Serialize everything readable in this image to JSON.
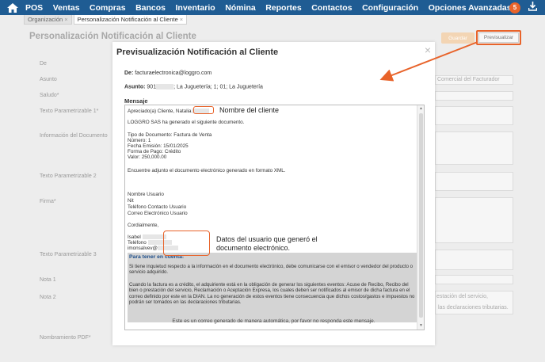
{
  "nav": {
    "items": [
      "POS",
      "Ventas",
      "Compras",
      "Bancos",
      "Inventario",
      "Nómina",
      "Reportes",
      "Contactos",
      "Configuración",
      "Opciones Avanzadas"
    ],
    "notification_count": "5"
  },
  "tabs": [
    {
      "label": "Organización",
      "close": "×"
    },
    {
      "label": "Personalización Notificación al Cliente",
      "close": "×"
    }
  ],
  "page": {
    "title": "Personalización Notificación al Cliente",
    "save_label": "Guardar",
    "preview_label": "Previsualizar",
    "labels": [
      "De",
      "Asunto",
      "Saludo*",
      "Texto Parametrizable 1*",
      "Información del Documento",
      "Texto Parametrizable 2",
      "Firma*",
      "Texto Parametrizable 3",
      "Nota 1",
      "Nota 2",
      "Nombramiento PDF*"
    ],
    "asunto_fragment": "Comercial del Facturador",
    "nota2_line1": "estación del servicio,",
    "nota2_line2": "las declaraciones tributarias."
  },
  "modal": {
    "title": "Previsualización Notificación al Cliente",
    "close": "×",
    "de_label": "De:",
    "de_value": "facturaelectronica@loggro.com",
    "asunto_label": "Asunto:",
    "asunto_prefix": "901",
    "asunto_rest": "; La Juguetería; 1; 01; La Juguetería",
    "mensaje_label": "Mensaje",
    "msg": {
      "greeting": "Apreciado(a) Cliente,",
      "greeting_name": "Natalia",
      "intro": "LOGGRO SAS ha generado el siguiente documento.",
      "doc_type_label": "Tipo de Documento:",
      "doc_type_value": "Factura de Venta",
      "number_label": "Número:",
      "number_value": "1",
      "date_label": "Fecha Emisión:",
      "date_value": "15/01/2025",
      "payment_label": "Forma de Pago:",
      "payment_value": "Crédito",
      "value_label": "Valor:",
      "value_value": "250,000.00",
      "attach": "Encuentre adjunto el documento electrónico generado en formato XML.",
      "user_lines": [
        "Nombre Usuario",
        "Nit",
        "Teléfono Contacto Usuario",
        "Correo Electrónico Usuario"
      ],
      "closing": "Cordialmente,",
      "sign_name": "Isabel",
      "sign_phone": "Teléfono",
      "sign_email": "imonsalvev@",
      "info_title": "Para tener en cuenta:",
      "info_p1": "Si tiene inquietud respecto a la información en el documento electrónico, debe comunicarse con el emisor o vendedor del producto o servicio adquirido.",
      "info_p2": "Cuando la factura es a crédito, el adquiriente está en la obligación de generar los siguientes eventos: Acuse de Recibo, Recibo del bien o prestación del servicio, Reclamación o Aceptación Expresa, los cuales deben ser notificados al emisor de dicha factura en el correo definido por este en la DIAN. La no generación de estos eventos tiene consecuencia que dichos costos/gastos e impuestos no podrán ser tomados en las declaraciones tributarias."
    },
    "footer": "Este es un correo generado de manera automática, por favor no responda este mensaje."
  },
  "annotations": {
    "client_name": "Nombre del cliente",
    "user_data": "Datos del usuario que generó el documento electrónico."
  },
  "colors": {
    "nav_bg": "#1f5c93",
    "accent": "#e8632a",
    "info_bg": "#d4d4d4"
  }
}
